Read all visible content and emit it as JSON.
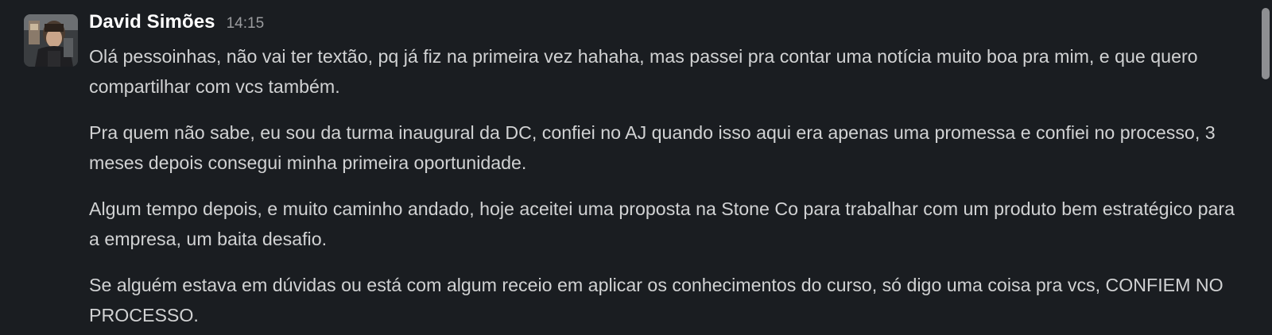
{
  "message": {
    "author": "David Simões",
    "timestamp": "14:15",
    "avatar_icon": "user-avatar-photo",
    "paragraphs": [
      "Olá pessoinhas, não vai ter textão, pq já fiz na primeira vez hahaha, mas passei pra contar uma notícia muito boa pra mim, e que quero compartilhar com vcs também.",
      "Pra quem não sabe, eu sou da turma inaugural da DC, confiei no AJ quando isso aqui era apenas uma promessa e confiei no processo, 3 meses depois consegui minha primeira oportunidade.",
      "Algum tempo depois, e muito caminho andado, hoje aceitei uma proposta na Stone Co para trabalhar com um produto bem estratégico para a empresa, um baita desafio.",
      "Se alguém estava em dúvidas ou está com algum receio em aplicar os conhecimentos do curso, só digo uma coisa pra vcs, CONFIEM NO PROCESSO."
    ]
  },
  "colors": {
    "background": "#1a1d21",
    "text": "#d1d2d3",
    "author": "#ffffff",
    "timestamp": "#9a9b9e",
    "scrollbar": "#8e8f92"
  }
}
